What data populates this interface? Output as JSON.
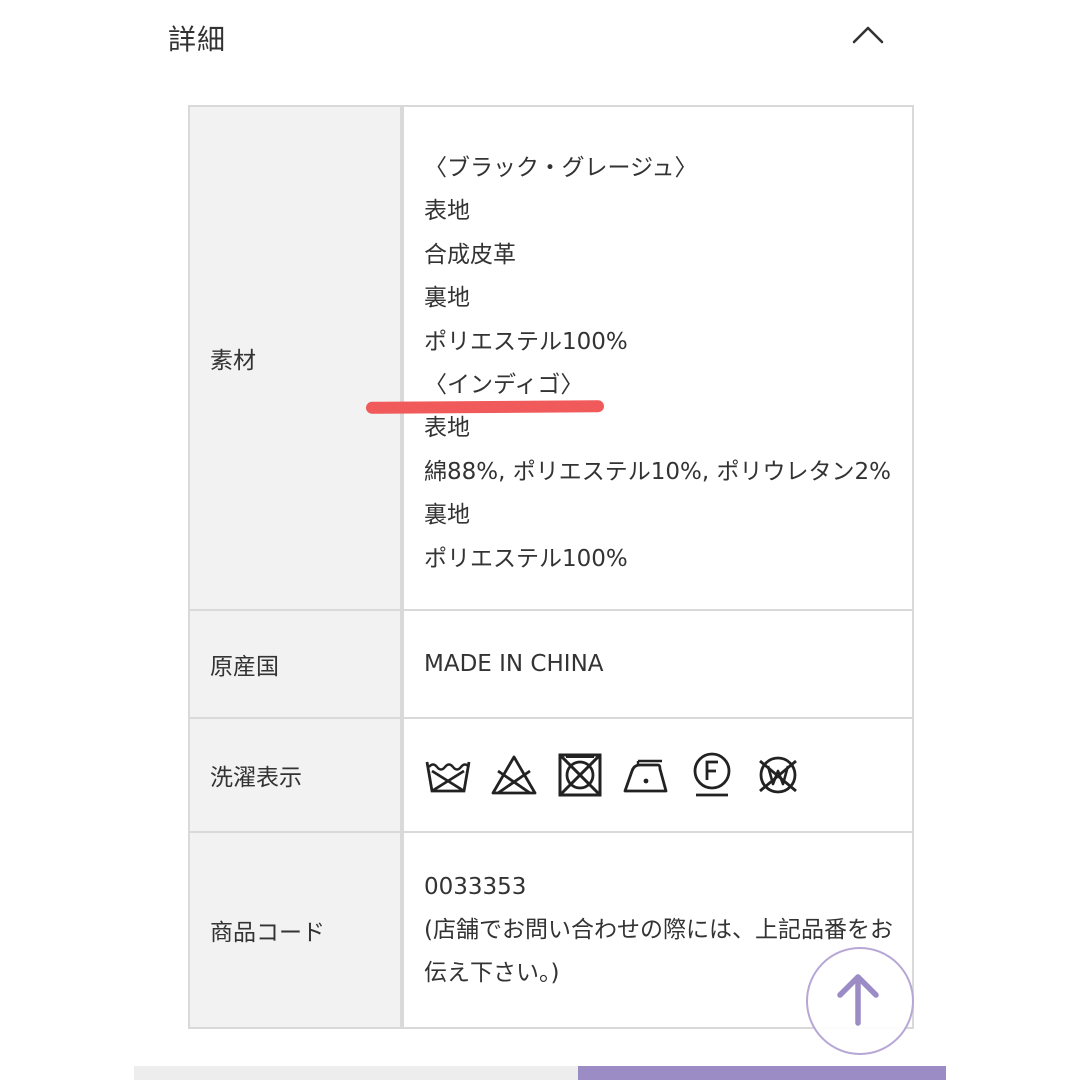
{
  "section": {
    "title": "詳細",
    "toggle_icon": "chevron-up-icon"
  },
  "spec": {
    "material": {
      "label": "素材",
      "lines": [
        "〈ブラック・グレージュ〉",
        "表地",
        "合成皮革",
        "裏地",
        "ポリエステル100%",
        "〈インディゴ〉",
        "表地",
        "綿88%, ポリエステル10%, ポリウレタン2%",
        "裏地",
        "ポリエステル100%"
      ]
    },
    "origin": {
      "label": "原産国",
      "value": "MADE IN CHINA"
    },
    "care": {
      "label": "洗濯表示",
      "icons": [
        "hand-wash-icon",
        "no-bleach-icon",
        "no-tumble-dry-icon",
        "iron-low-icon",
        "dry-clean-f-icon",
        "no-wet-clean-icon"
      ]
    },
    "code": {
      "label": "商品コード",
      "value": "0033353",
      "note_line1": "(店舗でお問い合わせの際には、上記品番をお",
      "note_line2": "伝え下さい。)"
    }
  },
  "annotation": {
    "highlight_color": "#f05a5a"
  },
  "scroll_top": {
    "icon": "arrow-up-icon",
    "color": "#9c8cc6"
  },
  "colors": {
    "accent": "#9c8cc6",
    "label_bg": "#f2f2f2",
    "border": "#d9d9d9"
  }
}
